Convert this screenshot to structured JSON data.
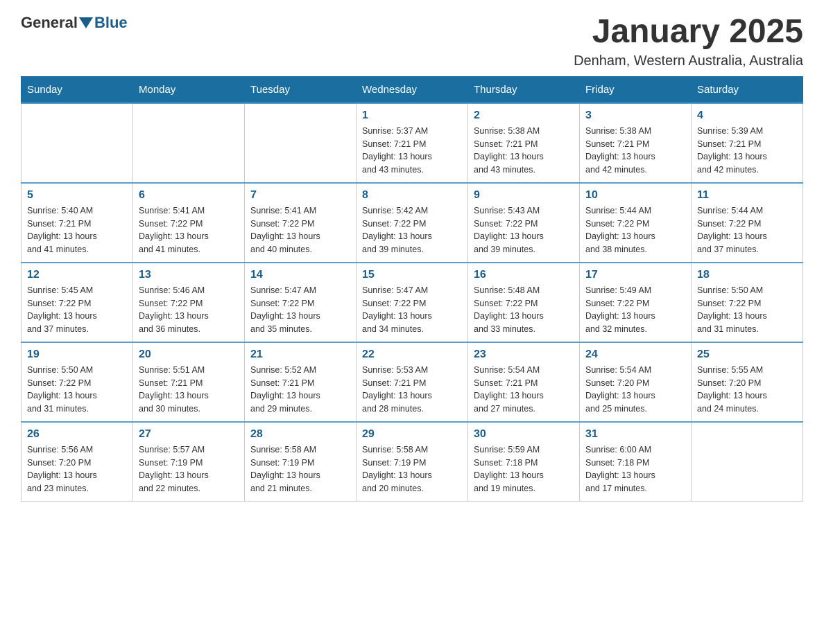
{
  "header": {
    "logo_general": "General",
    "logo_blue": "Blue",
    "title": "January 2025",
    "subtitle": "Denham, Western Australia, Australia"
  },
  "days_of_week": [
    "Sunday",
    "Monday",
    "Tuesday",
    "Wednesday",
    "Thursday",
    "Friday",
    "Saturday"
  ],
  "weeks": [
    [
      {
        "day": "",
        "info": ""
      },
      {
        "day": "",
        "info": ""
      },
      {
        "day": "",
        "info": ""
      },
      {
        "day": "1",
        "info": "Sunrise: 5:37 AM\nSunset: 7:21 PM\nDaylight: 13 hours\nand 43 minutes."
      },
      {
        "day": "2",
        "info": "Sunrise: 5:38 AM\nSunset: 7:21 PM\nDaylight: 13 hours\nand 43 minutes."
      },
      {
        "day": "3",
        "info": "Sunrise: 5:38 AM\nSunset: 7:21 PM\nDaylight: 13 hours\nand 42 minutes."
      },
      {
        "day": "4",
        "info": "Sunrise: 5:39 AM\nSunset: 7:21 PM\nDaylight: 13 hours\nand 42 minutes."
      }
    ],
    [
      {
        "day": "5",
        "info": "Sunrise: 5:40 AM\nSunset: 7:21 PM\nDaylight: 13 hours\nand 41 minutes."
      },
      {
        "day": "6",
        "info": "Sunrise: 5:41 AM\nSunset: 7:22 PM\nDaylight: 13 hours\nand 41 minutes."
      },
      {
        "day": "7",
        "info": "Sunrise: 5:41 AM\nSunset: 7:22 PM\nDaylight: 13 hours\nand 40 minutes."
      },
      {
        "day": "8",
        "info": "Sunrise: 5:42 AM\nSunset: 7:22 PM\nDaylight: 13 hours\nand 39 minutes."
      },
      {
        "day": "9",
        "info": "Sunrise: 5:43 AM\nSunset: 7:22 PM\nDaylight: 13 hours\nand 39 minutes."
      },
      {
        "day": "10",
        "info": "Sunrise: 5:44 AM\nSunset: 7:22 PM\nDaylight: 13 hours\nand 38 minutes."
      },
      {
        "day": "11",
        "info": "Sunrise: 5:44 AM\nSunset: 7:22 PM\nDaylight: 13 hours\nand 37 minutes."
      }
    ],
    [
      {
        "day": "12",
        "info": "Sunrise: 5:45 AM\nSunset: 7:22 PM\nDaylight: 13 hours\nand 37 minutes."
      },
      {
        "day": "13",
        "info": "Sunrise: 5:46 AM\nSunset: 7:22 PM\nDaylight: 13 hours\nand 36 minutes."
      },
      {
        "day": "14",
        "info": "Sunrise: 5:47 AM\nSunset: 7:22 PM\nDaylight: 13 hours\nand 35 minutes."
      },
      {
        "day": "15",
        "info": "Sunrise: 5:47 AM\nSunset: 7:22 PM\nDaylight: 13 hours\nand 34 minutes."
      },
      {
        "day": "16",
        "info": "Sunrise: 5:48 AM\nSunset: 7:22 PM\nDaylight: 13 hours\nand 33 minutes."
      },
      {
        "day": "17",
        "info": "Sunrise: 5:49 AM\nSunset: 7:22 PM\nDaylight: 13 hours\nand 32 minutes."
      },
      {
        "day": "18",
        "info": "Sunrise: 5:50 AM\nSunset: 7:22 PM\nDaylight: 13 hours\nand 31 minutes."
      }
    ],
    [
      {
        "day": "19",
        "info": "Sunrise: 5:50 AM\nSunset: 7:22 PM\nDaylight: 13 hours\nand 31 minutes."
      },
      {
        "day": "20",
        "info": "Sunrise: 5:51 AM\nSunset: 7:21 PM\nDaylight: 13 hours\nand 30 minutes."
      },
      {
        "day": "21",
        "info": "Sunrise: 5:52 AM\nSunset: 7:21 PM\nDaylight: 13 hours\nand 29 minutes."
      },
      {
        "day": "22",
        "info": "Sunrise: 5:53 AM\nSunset: 7:21 PM\nDaylight: 13 hours\nand 28 minutes."
      },
      {
        "day": "23",
        "info": "Sunrise: 5:54 AM\nSunset: 7:21 PM\nDaylight: 13 hours\nand 27 minutes."
      },
      {
        "day": "24",
        "info": "Sunrise: 5:54 AM\nSunset: 7:20 PM\nDaylight: 13 hours\nand 25 minutes."
      },
      {
        "day": "25",
        "info": "Sunrise: 5:55 AM\nSunset: 7:20 PM\nDaylight: 13 hours\nand 24 minutes."
      }
    ],
    [
      {
        "day": "26",
        "info": "Sunrise: 5:56 AM\nSunset: 7:20 PM\nDaylight: 13 hours\nand 23 minutes."
      },
      {
        "day": "27",
        "info": "Sunrise: 5:57 AM\nSunset: 7:19 PM\nDaylight: 13 hours\nand 22 minutes."
      },
      {
        "day": "28",
        "info": "Sunrise: 5:58 AM\nSunset: 7:19 PM\nDaylight: 13 hours\nand 21 minutes."
      },
      {
        "day": "29",
        "info": "Sunrise: 5:58 AM\nSunset: 7:19 PM\nDaylight: 13 hours\nand 20 minutes."
      },
      {
        "day": "30",
        "info": "Sunrise: 5:59 AM\nSunset: 7:18 PM\nDaylight: 13 hours\nand 19 minutes."
      },
      {
        "day": "31",
        "info": "Sunrise: 6:00 AM\nSunset: 7:18 PM\nDaylight: 13 hours\nand 17 minutes."
      },
      {
        "day": "",
        "info": ""
      }
    ]
  ]
}
